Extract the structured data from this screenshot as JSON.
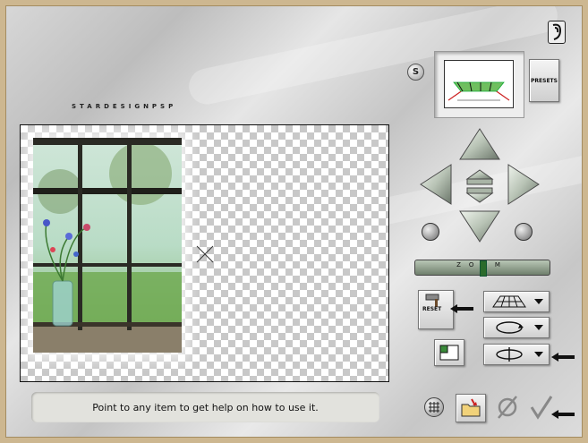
{
  "brand": {
    "text": "STARDESIGNPSP"
  },
  "help": {
    "status_text": "Point to any item to get help on how to use it."
  },
  "presets": {
    "label": "PRESETS"
  },
  "s_button": {
    "label": "S"
  },
  "reset": {
    "label": "RESET"
  },
  "zoom": {
    "label": "ZOOM",
    "level": 0.5
  },
  "colors": {
    "frame": "#cdb790",
    "panel": "#d0d0d0",
    "nav_button": "#b7c2b4",
    "zoom_track": "#8a9a87",
    "statusbar": "#e2e2dd"
  },
  "icons": {
    "help": "help-book-icon",
    "grid": "grid-icon",
    "open": "open-folder-icon",
    "cancel": "cancel-icon",
    "ok": "checkmark-icon",
    "reset": "hammer-icon",
    "perspective": "perspective-plane-icon",
    "rotate": "rotate-icon",
    "flip": "flip-icon"
  }
}
